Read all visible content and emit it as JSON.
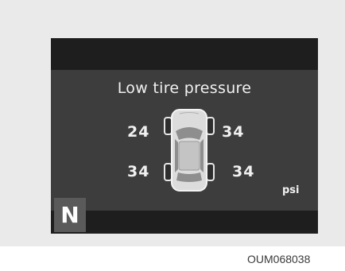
{
  "display": {
    "message": "Low tire pressure",
    "tires": {
      "front_left": "24",
      "front_right": "34",
      "rear_left": "34",
      "rear_right": "34"
    },
    "unit": "psi",
    "gear": "N"
  },
  "caption": "OUM068038",
  "colors": {
    "panel_background": "#eaeaea",
    "display_background": "#3d3d3d",
    "display_band": "#1e1e1e",
    "text": "#f1f1f1",
    "gear_box": "#5a5a5a"
  }
}
